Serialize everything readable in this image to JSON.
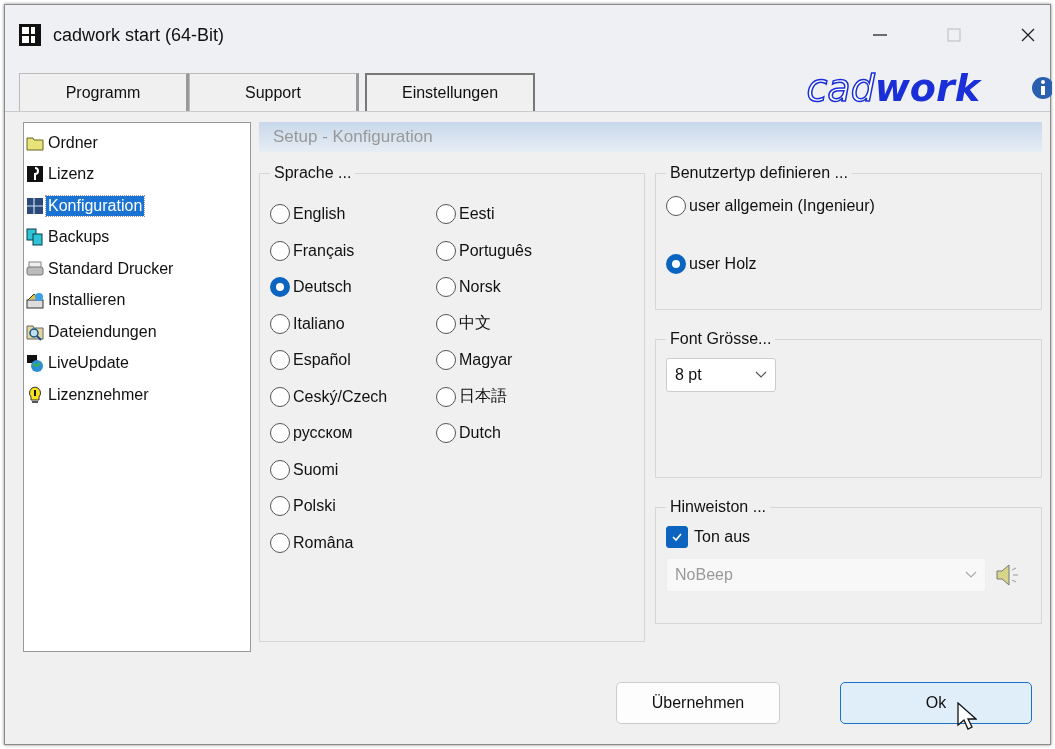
{
  "window": {
    "title": "cadwork start (64-Bit)",
    "maximize_disabled": true
  },
  "tabs": [
    {
      "label": "Programm",
      "selected": false
    },
    {
      "label": "Support",
      "selected": false
    },
    {
      "label": "Einstellungen",
      "selected": true
    }
  ],
  "logo": {
    "prefix": "cad",
    "suffix": "work"
  },
  "sidebar": {
    "items": [
      {
        "label": "Ordner",
        "selected": false
      },
      {
        "label": "Lizenz",
        "selected": false
      },
      {
        "label": "Konfiguration",
        "selected": true
      },
      {
        "label": "Backups",
        "selected": false
      },
      {
        "label": "Standard Drucker",
        "selected": false
      },
      {
        "label": "Installieren",
        "selected": false
      },
      {
        "label": "Dateiendungen",
        "selected": false
      },
      {
        "label": "LiveUpdate",
        "selected": false
      },
      {
        "label": "Lizenznehmer",
        "selected": false
      }
    ]
  },
  "panel": {
    "title": "Setup - Konfiguration",
    "language": {
      "legend": "Sprache ...",
      "options": [
        {
          "label": "English",
          "selected": false
        },
        {
          "label": "Français",
          "selected": false
        },
        {
          "label": "Deutsch",
          "selected": true
        },
        {
          "label": "Italiano",
          "selected": false
        },
        {
          "label": "Español",
          "selected": false
        },
        {
          "label": "Ceský/Czech",
          "selected": false
        },
        {
          "label": "русском",
          "selected": false
        },
        {
          "label": "Suomi",
          "selected": false
        },
        {
          "label": "Polski",
          "selected": false
        },
        {
          "label": "Româna",
          "selected": false
        },
        {
          "label": "Eesti",
          "selected": false
        },
        {
          "label": "Português",
          "selected": false
        },
        {
          "label": "Norsk",
          "selected": false
        },
        {
          "label": "中文",
          "selected": false
        },
        {
          "label": "Magyar",
          "selected": false
        },
        {
          "label": "日本語",
          "selected": false
        },
        {
          "label": "Dutch",
          "selected": false
        }
      ]
    },
    "user_type": {
      "legend": "Benutzertyp definieren ...",
      "options": [
        {
          "label": "user allgemein (Ingenieur)",
          "selected": false
        },
        {
          "label": "user Holz",
          "selected": true
        }
      ]
    },
    "font_size": {
      "legend": "Font Grösse...",
      "value": "8 pt"
    },
    "notification": {
      "legend": "Hinweiston ...",
      "checkbox": {
        "label": "Ton aus",
        "checked": true
      },
      "sound": {
        "value": "NoBeep",
        "disabled": true
      }
    }
  },
  "buttons": [
    {
      "label": "Übernehmen",
      "default": false
    },
    {
      "label": "Ok",
      "default": true
    }
  ]
}
